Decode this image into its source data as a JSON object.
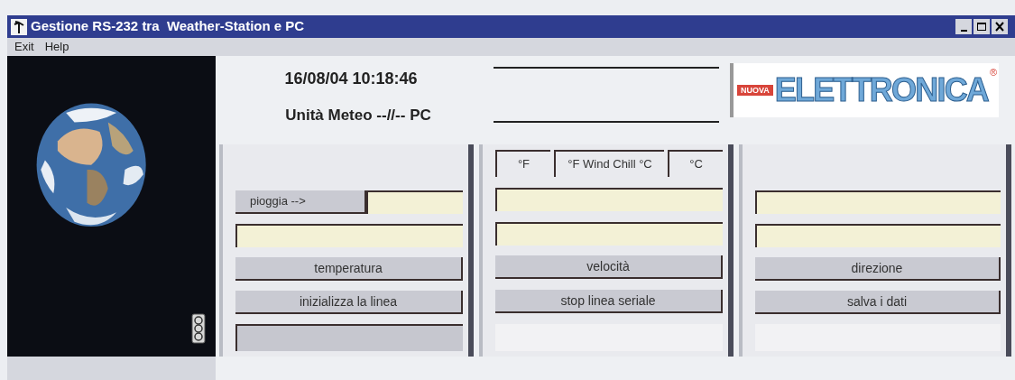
{
  "window": {
    "title": "Gestione RS-232 tra  Weather-Station e PC"
  },
  "menu": [
    "Exit",
    "Help"
  ],
  "header": {
    "datetime": "16/08/04 10:18:46",
    "subtitle": "Unità Meteo --//-- PC"
  },
  "logo": {
    "badge": "NUOVA",
    "name": "ELETTRONICA",
    "mark": "®"
  },
  "columns": [
    {
      "cells": [
        {
          "kind": "blank"
        },
        {
          "kind": "labeled_field",
          "label": "pioggia -->"
        },
        {
          "kind": "field"
        },
        {
          "kind": "button",
          "label": "temperatura"
        },
        {
          "kind": "button",
          "label": "inizializza la linea"
        },
        {
          "kind": "status",
          "disabled": true
        }
      ]
    },
    {
      "cells": [
        {
          "kind": "units",
          "labels": [
            "°F",
            "°F Wind Chill °C",
            "°C"
          ]
        },
        {
          "kind": "field"
        },
        {
          "kind": "field"
        },
        {
          "kind": "button",
          "label": "velocità"
        },
        {
          "kind": "button",
          "label": "stop  linea seriale"
        },
        {
          "kind": "status",
          "disabled": false
        }
      ]
    },
    {
      "cells": [
        {
          "kind": "blank"
        },
        {
          "kind": "field"
        },
        {
          "kind": "field"
        },
        {
          "kind": "button",
          "label": "direzione"
        },
        {
          "kind": "button",
          "label": "salva i  dati"
        },
        {
          "kind": "status",
          "disabled": false
        }
      ]
    }
  ]
}
